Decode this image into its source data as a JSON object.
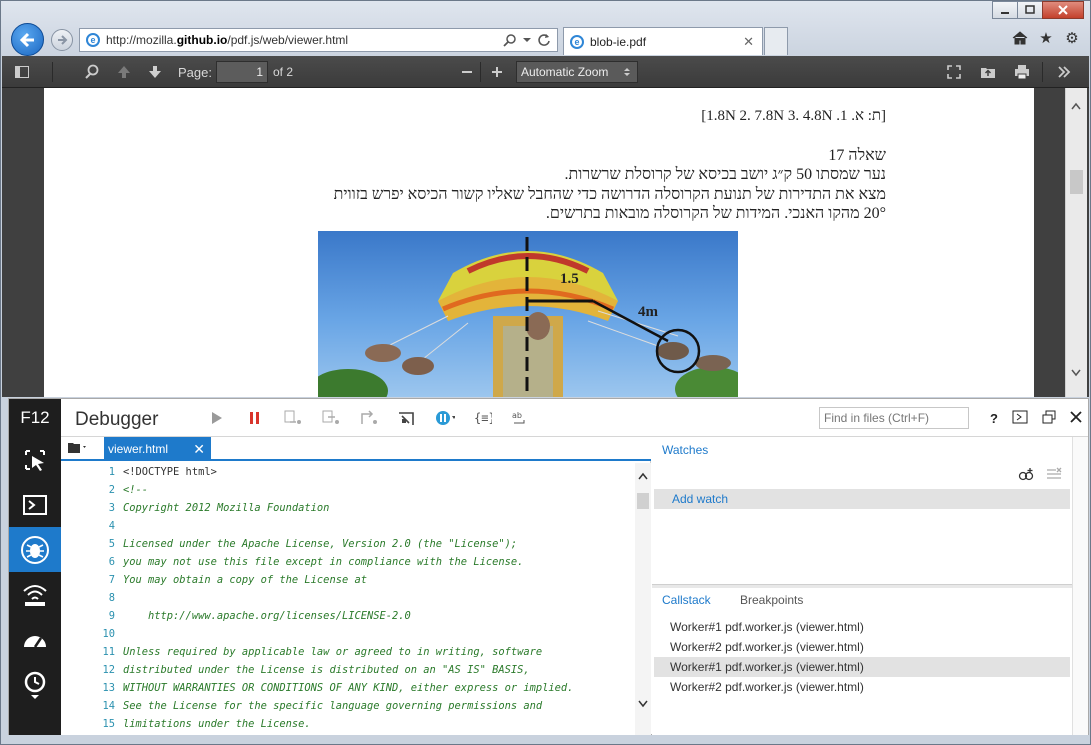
{
  "browser": {
    "url_prefix": "http://mozilla.",
    "url_host": "github.io",
    "url_suffix": "/pdf.js/web/viewer.html",
    "tab_title": "blob-ie.pdf"
  },
  "pdf_toolbar": {
    "page_label": "Page:",
    "page_value": "1",
    "page_of": "of 2",
    "zoom": "Automatic Zoom"
  },
  "document": {
    "answer_line": "[ת: א. 1.  1.8N  2.  7.8N  3.  4.8N]",
    "question_title": "שאלה 17",
    "question_lines": [
      "נער שמסתו  50 ק״ג יושב בכיסא של קרוסלת שרשרות.",
      "מצא את התדירות של תנועת הקרוסלה  הדרושה כדי שהחבל שאליו קשור הכיסא יפרש בזווית",
      "20° מהקו האנכי. המידות של הקרוסלה מובאות בתרשים."
    ],
    "figure_label_radius": "1.5",
    "figure_label_rope": "4m"
  },
  "devtools": {
    "f12_label": "F12",
    "title": "Debugger",
    "find_placeholder": "Find in files (Ctrl+F)",
    "help": "?",
    "file_tab": "viewer.html",
    "code_lines": [
      {
        "n": "1",
        "t": "<!DOCTYPE html>"
      },
      {
        "n": "2",
        "t": "<!--"
      },
      {
        "n": "3",
        "t": "Copyright 2012 Mozilla Foundation"
      },
      {
        "n": "4",
        "t": ""
      },
      {
        "n": "5",
        "t": "Licensed under the Apache License, Version 2.0 (the \"License\");"
      },
      {
        "n": "6",
        "t": "you may not use this file except in compliance with the License."
      },
      {
        "n": "7",
        "t": "You may obtain a copy of the License at"
      },
      {
        "n": "8",
        "t": ""
      },
      {
        "n": "9",
        "t": "    http://www.apache.org/licenses/LICENSE-2.0"
      },
      {
        "n": "10",
        "t": ""
      },
      {
        "n": "11",
        "t": "Unless required by applicable law or agreed to in writing, software"
      },
      {
        "n": "12",
        "t": "distributed under the License is distributed on an \"AS IS\" BASIS,"
      },
      {
        "n": "13",
        "t": "WITHOUT WARRANTIES OR CONDITIONS OF ANY KIND, either express or implied."
      },
      {
        "n": "14",
        "t": "See the License for the specific language governing permissions and"
      },
      {
        "n": "15",
        "t": "limitations under the License."
      }
    ],
    "watches_label": "Watches",
    "add_watch": "Add watch",
    "callstack_label": "Callstack",
    "breakpoints_label": "Breakpoints",
    "callstack": [
      "Worker#1 pdf.worker.js (viewer.html)",
      "Worker#2 pdf.worker.js (viewer.html)",
      "Worker#1 pdf.worker.js (viewer.html)",
      "Worker#2 pdf.worker.js (viewer.html)"
    ],
    "selected_callstack_index": 2
  },
  "colors": {
    "accent": "#1e7acb",
    "sidebar_bg": "#1e1e1e",
    "pdf_toolbar_bg": "#474747"
  }
}
